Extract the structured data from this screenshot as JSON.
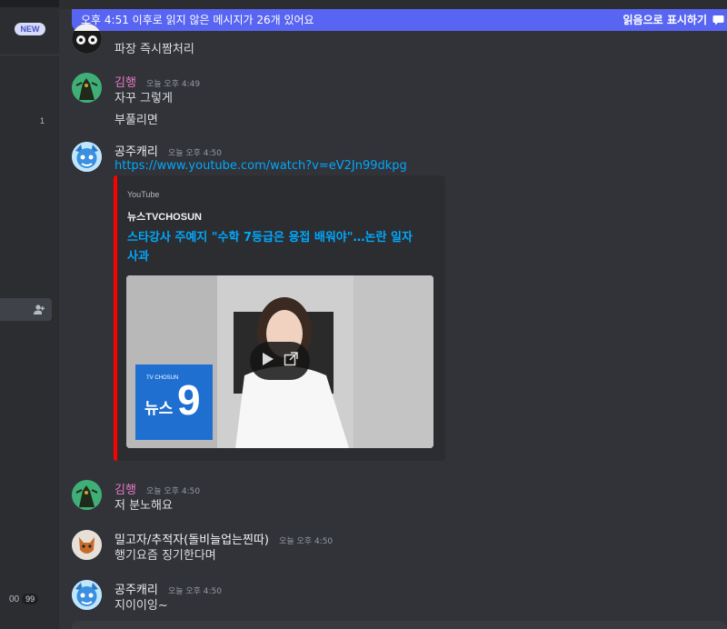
{
  "sidebar": {
    "new_badge": "NEW",
    "unread_count": "1",
    "bottom_left": "00",
    "bottom_pill": "99"
  },
  "unread_banner": {
    "text": "오후 4:51 이후로 읽지 않은 메시지가 26개 있어요",
    "mark_read": "읽음으로 표시하기"
  },
  "messages": [
    {
      "lines": [
        "파장 즉시짬처리"
      ]
    },
    {
      "author": "김행",
      "author_color": "#e879c6",
      "timestamp": "오늘 오후 4:49",
      "lines": [
        "자꾸 그렇게",
        "부풀리면"
      ]
    },
    {
      "author": "공주캐리",
      "timestamp": "오늘 오후 4:50",
      "link": "https://www.youtube.com/watch?v=eV2Jn99dkpg",
      "embed": {
        "provider": "YouTube",
        "author": "뉴스TVCHOSUN",
        "title_line1": "스타강사 주예지 \"수학 7등급은 용접 배워야\"…논란 일자",
        "title_line2": "사과",
        "accent": "#ff0000",
        "logo_small": "TV CHOSUN",
        "logo_big": "뉴스",
        "logo_num": "9"
      }
    },
    {
      "author": "김행",
      "timestamp": "오늘 오후 4:50",
      "lines": [
        "저 분노해요"
      ]
    },
    {
      "author": "밀고자/추적자(돌비늘업는찐따)",
      "timestamp": "오늘 오후 4:50",
      "lines": [
        "행기요즘 징기한다며"
      ]
    },
    {
      "author": "공주캐리",
      "timestamp": "오늘 오후 4:50",
      "lines": [
        "지이이잉~"
      ]
    }
  ],
  "icons": [
    "add-user-icon",
    "mark-read-icon",
    "play-icon",
    "external-link-icon"
  ],
  "colors": {
    "accent": "#5865f2",
    "link": "#00a8fc",
    "background": "#313338"
  }
}
